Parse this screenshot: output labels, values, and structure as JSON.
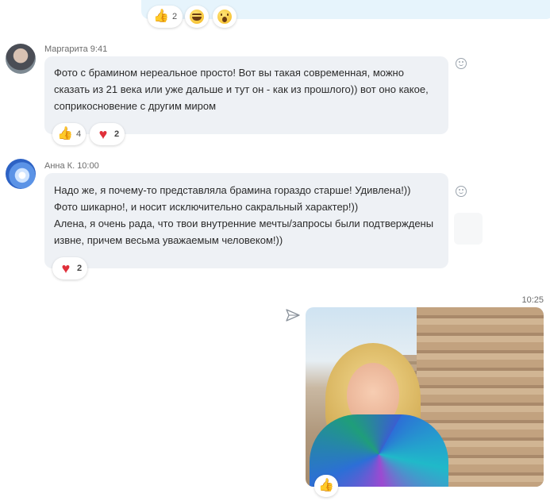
{
  "top_message": {
    "reactions": [
      {
        "icon": "thumbs-up-icon",
        "count": "2"
      },
      {
        "icon": "laughing-face-icon",
        "count": ""
      },
      {
        "icon": "surprised-face-icon",
        "count": ""
      }
    ]
  },
  "messages": [
    {
      "author": "Маргарита",
      "time": "9:41",
      "text": "Фото с брамином нереальное просто! Вот вы такая современная, можно сказать из 21 века или уже дальше и тут он - как из прошлого)) вот оно какое, соприкосновение с другим миром",
      "reactions": [
        {
          "icon": "thumbs-up-icon",
          "count": "4"
        },
        {
          "icon": "heart-icon",
          "count": "2"
        }
      ]
    },
    {
      "author": "Анна К.",
      "time": "10:00",
      "text_lines": [
        "Надо же, я почему-то представляла брамина гораздо старше! Удивлена!))",
        "Фото шикарно!, и носит исключительно сакральный характер!))",
        "Алена, я очень рада, что твои внутренние мечты/запросы были подтверждены извне, причем весьма уважаемым человеком!))"
      ],
      "reactions": [
        {
          "icon": "heart-icon",
          "count": "2"
        }
      ]
    }
  ],
  "outgoing_photo": {
    "time": "10:25",
    "reactions": [
      {
        "icon": "thumbs-up-icon",
        "count": ""
      }
    ]
  },
  "colors": {
    "bubble_incoming": "#eef1f5",
    "bubble_outgoing": "#e6f4fc",
    "heart": "#e0303a",
    "thumbs": "#f5b81d"
  }
}
